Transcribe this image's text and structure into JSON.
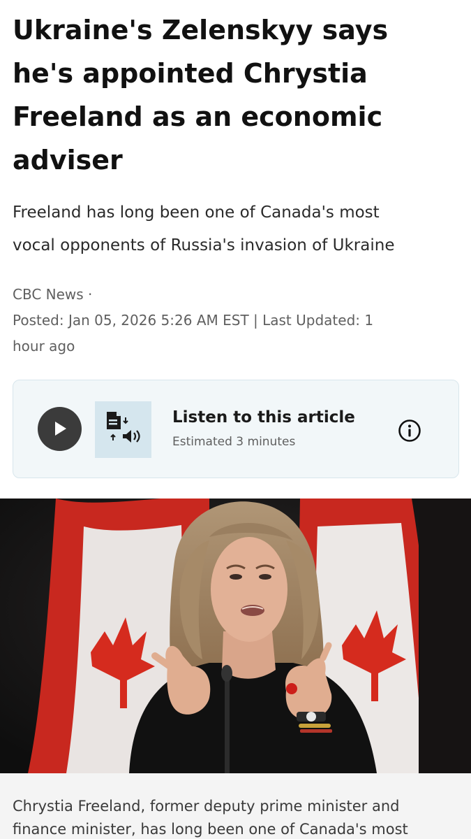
{
  "article": {
    "headline_lines": [
      "Ukraine's Zelenskyy says",
      "he's appointed Chrystia",
      "Freeland as an economic",
      "adviser"
    ],
    "deck_lines": [
      "Freeland has long been one of Canada's most",
      "vocal opponents of Russia's invasion of Ukraine"
    ],
    "byline": {
      "source": "CBC News ·",
      "dates_line1": "Posted: Jan 05, 2026 5:26 AM EST | Last Updated: 1",
      "dates_line2": "hour ago"
    }
  },
  "audio_player": {
    "title": "Listen to this article",
    "subtitle": "Estimated 3 minutes",
    "icons": {
      "play": "play-icon",
      "thumbnail": "text-to-speech-icon",
      "info": "info-icon"
    }
  },
  "photo": {
    "subject": "woman with shoulder-length highlighted hair in a black top gesturing at a microphone, Canadian flags behind"
  },
  "caption": {
    "lines": [
      "Chrystia Freeland, former deputy prime minister and",
      "finance minister, has long been one of Canada's most"
    ]
  },
  "colors": {
    "headline": "#111111",
    "card_background": "#f2f7f9",
    "play_button": "#3b3b3b",
    "flag_red": "#d52b1e"
  }
}
